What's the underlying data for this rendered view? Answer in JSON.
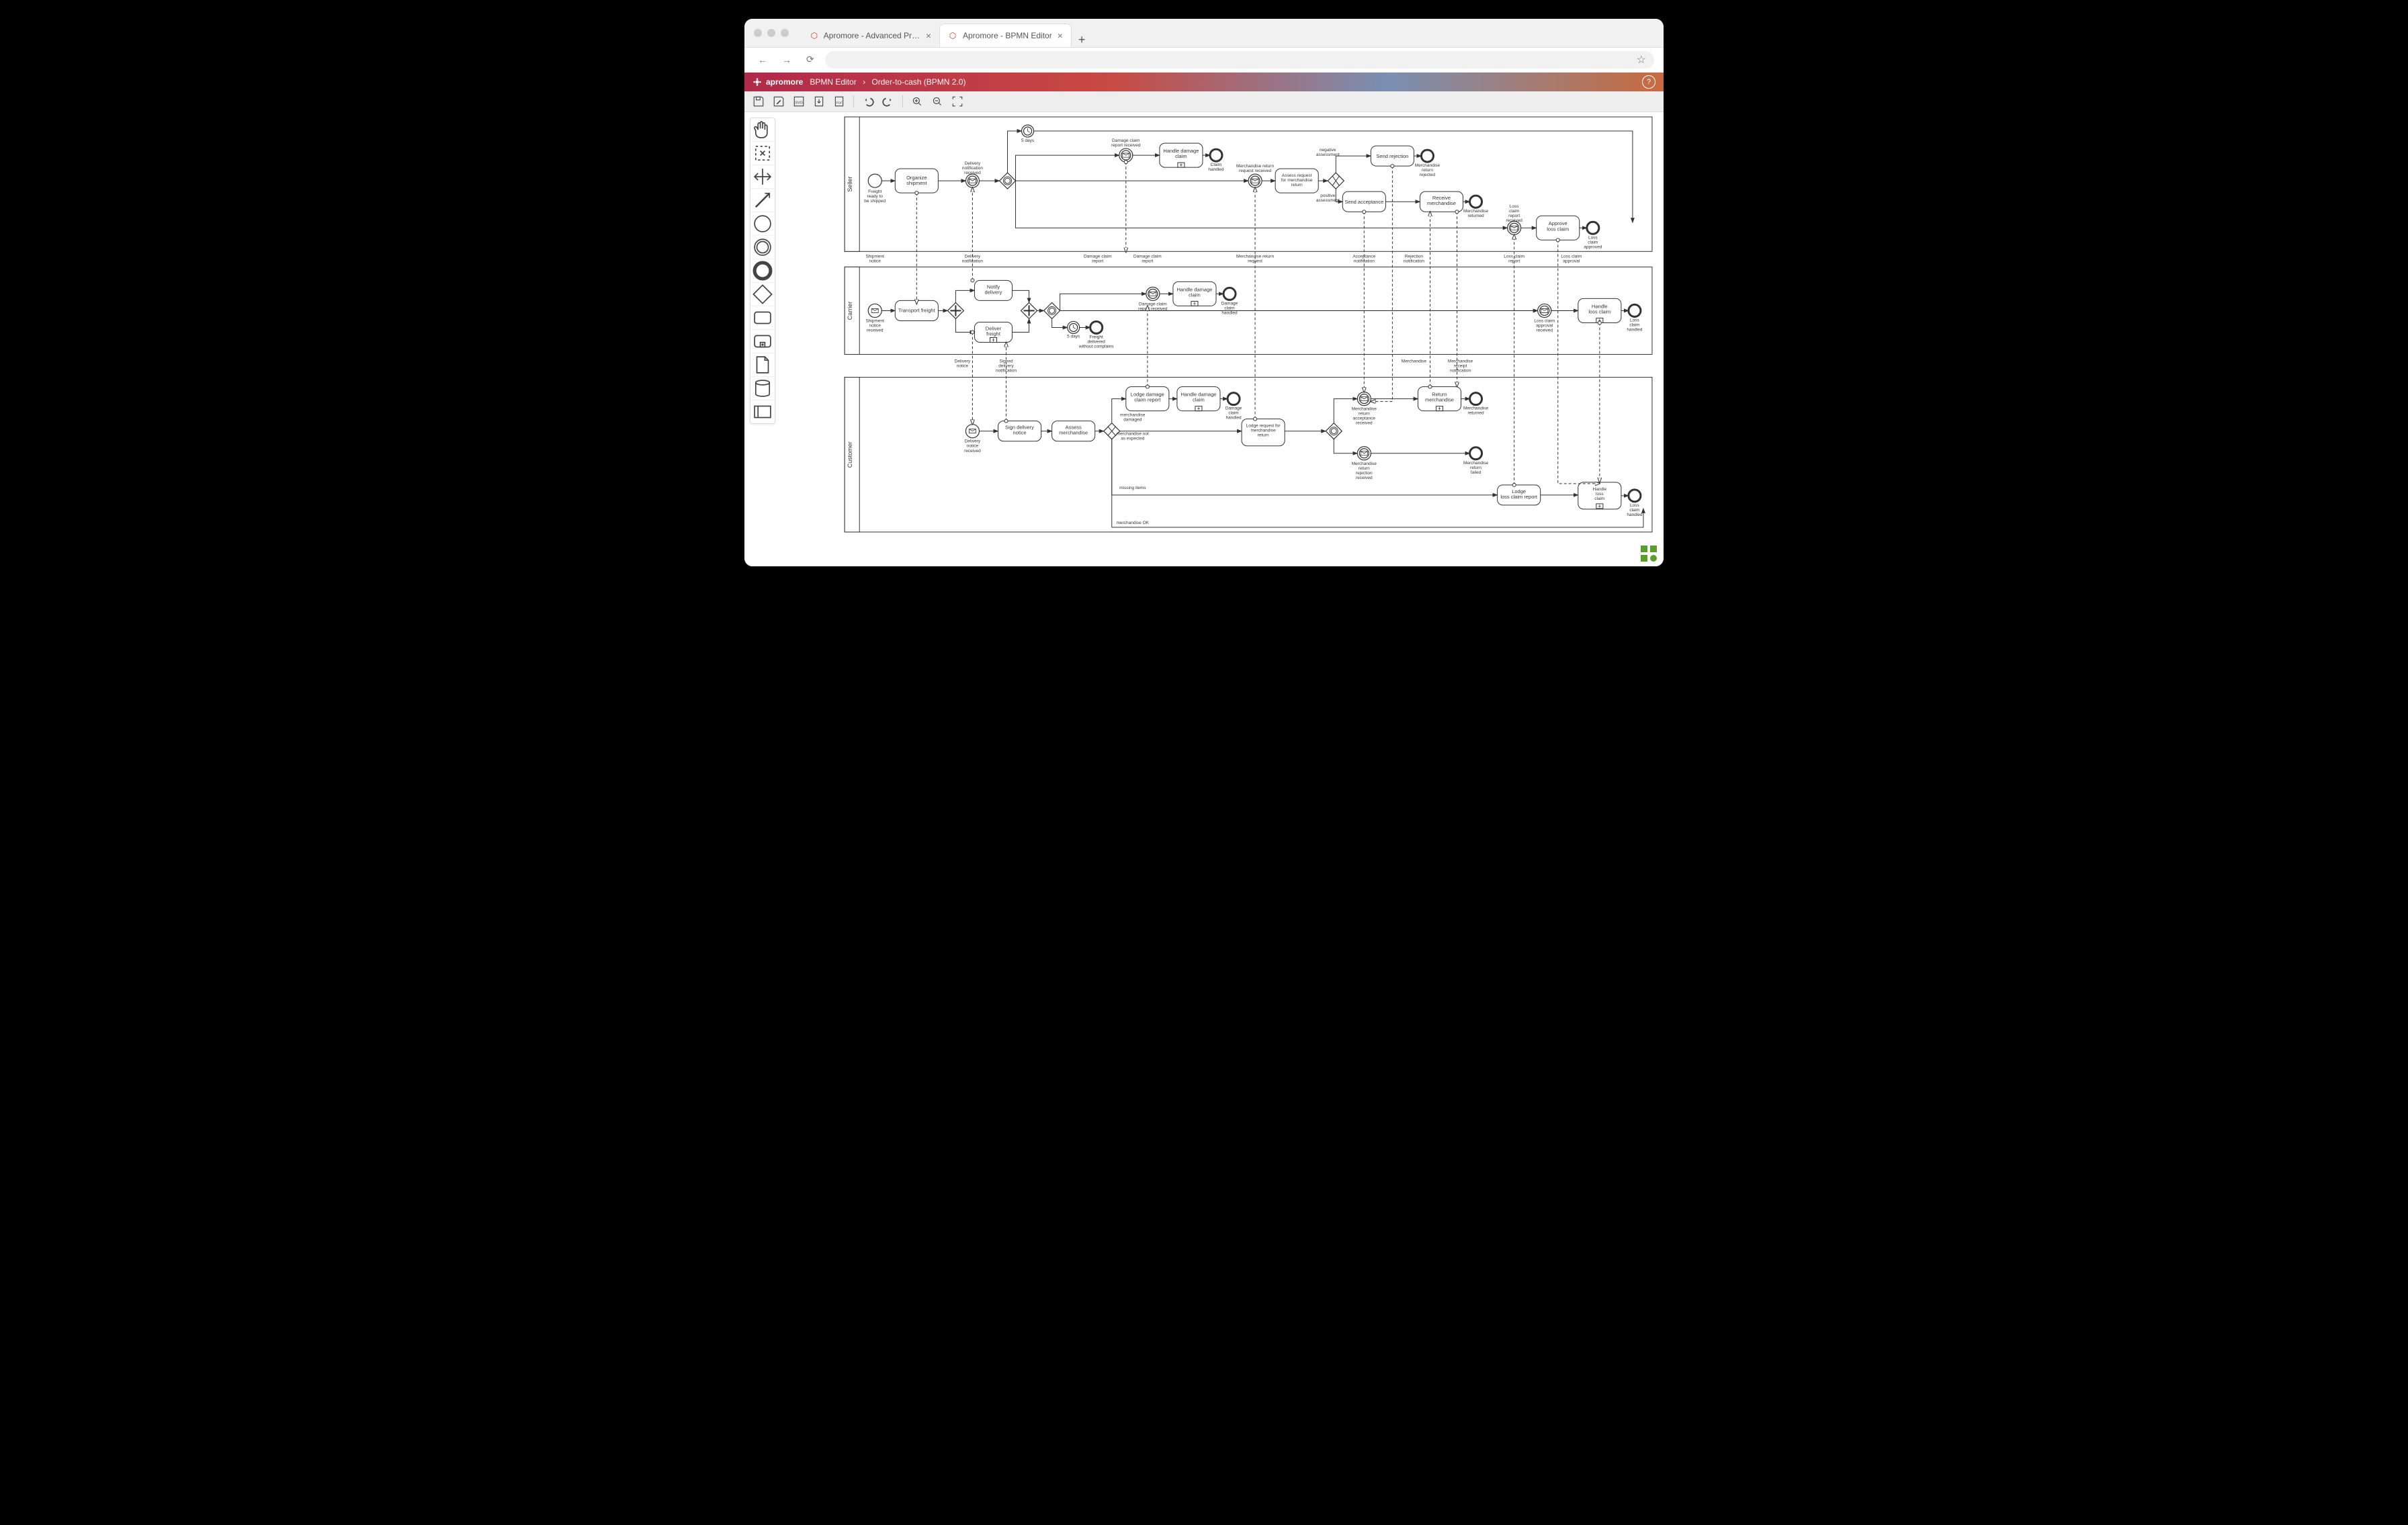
{
  "browser": {
    "tabs": [
      {
        "title": "Apromore - Advanced Process A",
        "active": false
      },
      {
        "title": "Apromore - BPMN Editor",
        "active": true
      }
    ]
  },
  "header": {
    "brand": "apromore",
    "breadcrumb": [
      "BPMN Editor",
      "Order-to-cash (BPMN 2.0)"
    ]
  },
  "toolbar": {
    "items": [
      "save",
      "edit",
      "svg-export",
      "export",
      "pdf",
      "undo",
      "redo",
      "zoom-in",
      "zoom-out",
      "fit"
    ]
  },
  "palette": {
    "items": [
      "hand",
      "lasso",
      "space",
      "connect",
      "start-event",
      "intermediate-event",
      "end-event",
      "gateway",
      "task",
      "subprocess",
      "data-object",
      "data-store",
      "participant"
    ]
  },
  "pools": [
    {
      "name": "Seller"
    },
    {
      "name": "Carrier"
    },
    {
      "name": "Customer"
    }
  ],
  "tasks": {
    "organize_shipment": "Organize\nshipment",
    "handle_damage_claim_seller": "Handle damage\nclaim",
    "assess_request": "Assess request\nfor merchandise\nreturn",
    "send_rejection": "Send rejection",
    "send_acceptance": "Send acceptance",
    "receive_merchandise": "Receive\nmerchandise",
    "approve_loss_claim": "Approve\nloss claim",
    "transport_freight": "Transport freight",
    "notify_delivery": "Notify\ndelivery",
    "deliver_freight": "Deliver\nfreight",
    "handle_damage_claim_carrier": "Handle damage\nclaim",
    "handle_loss_claim_carrier": "Handle\nloss claim",
    "sign_delivery_notice": "Sign delivery\nnotice",
    "assess_merchandise": "Assess\nmerchandise",
    "lodge_damage_claim": "Lodge damage\nclaim report",
    "handle_damage_claim_customer": "Handle damage\nclaim",
    "lodge_request_return": "Lodge request for\nmerchandise\nreturn",
    "return_merchandise": "Return\nmerchandise",
    "lodge_loss_claim": "Lodge\nloss claim report",
    "handle_loss_claim_customer": "Handle\nloss\nclaim"
  },
  "event_labels": {
    "freight_ready": "Freight\nready to\nbe shipped",
    "five_days": "5 days",
    "delivery_notification_received": "Delivery\nnotification\nreceived",
    "damage_claim_report_received": "Damage claim\nreport received",
    "claim_handled": "Claim\nhandled",
    "merchandise_return_request_received": "Merchandise return\nrequest received",
    "negative_assessment": "negative\nassessment",
    "positive_assessment": "positive\nassessment",
    "merchandise_return_rejected": "Merchandise\nreturn\nrejected",
    "merchandise_returned": "Merchandise\nreturned",
    "loss_claim_report_received": "Loss\nclaim\nreport\nreceived",
    "loss_claim_approved": "Loss\nclaim\napproved",
    "shipment_notice_received": "Shipment\nnotice\nreceived",
    "freight_delivered": "Freight\ndelivered\nwithout complains",
    "damage_claim_report_received2": "Damage claim\nreport received",
    "damage_claim_handled": "Damage\nclaim\nhandled",
    "loss_claim_approval_received": "Loss claim\napproval\nreceived",
    "loss_claim_handled": "Loss\nclaim\nhandled",
    "delivery_notice_received": "Delivery\nnotice\nreceived",
    "merchandise_return_acceptance_received": "Merchandise\nreturn\nacceptance\nreceived",
    "merchandise_return_rejection_received": "Merchandise\nreturn\nrejection\nreceived",
    "merchandise_returned_cust": "Merchandise\nreturned",
    "merchandise_return_failed": "Merchandise\nreturn\nfailed",
    "loss_claim_handled_cust": "Loss\nclaim\nhandled"
  },
  "flow_labels": {
    "shipment_notice": "Shipment\nnotice",
    "delivery_notification": "Delivery\nnotification",
    "damage_claim_report": "Damage claim\nreport",
    "damage_claim_report2": "Damage claim\nreport",
    "merchandise_return_request": "Merchandise return\nrequest",
    "acceptance_notification": "Acceptance\nnotification",
    "rejection_notification": "Rejection\nnotification",
    "loss_claim_report": "Loss claim\nreport",
    "loss_claim_approval": "Loss claim\napproval",
    "delivery_notice": "Delivery\nnotice",
    "signed_delivery_notification": "Signed\ndelivery\nnotification",
    "merchandise": "Merchandise",
    "merchandise_receipt_notification": "Merchandise\nreceipt\nnotification",
    "merchandise_damaged": "merchandise\ndamaged",
    "merchandise_not_as_expected": "merchandise not\nas expected",
    "missing_items": "missing items",
    "merchandise_ok": "merchandise OK"
  }
}
